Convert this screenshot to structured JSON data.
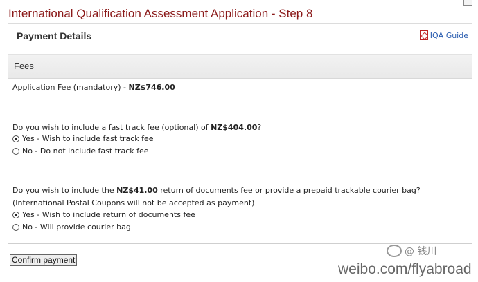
{
  "header": {
    "title": "International Qualification Assessment Application - Step 8"
  },
  "panel": {
    "section_title": "Payment Details",
    "guide_link": "IQA Guide",
    "guide_icon": "pdf-icon"
  },
  "fees": {
    "heading": "Fees",
    "application_fee_label": "Application Fee (mandatory) - ",
    "application_fee_amount": "NZ$746.00"
  },
  "fast_track": {
    "question_prefix": "Do you wish to include a fast track fee (optional) of ",
    "question_amount": "NZ$404.00",
    "question_suffix": "?",
    "options": [
      {
        "label": "Yes - Wish to include fast track fee",
        "selected": true
      },
      {
        "label": "No - Do not include fast track fee",
        "selected": false
      }
    ]
  },
  "return_docs": {
    "question_prefix": "Do you wish to include the ",
    "question_amount": "NZ$41.00",
    "question_suffix": " return of documents fee or provide a prepaid trackable courier bag?",
    "note": "(International Postal Coupons will not be accepted as payment)",
    "options": [
      {
        "label": "Yes - Wish to include return of documents fee",
        "selected": true
      },
      {
        "label": "No - Will provide courier bag",
        "selected": false
      }
    ]
  },
  "actions": {
    "confirm_label": "Confirm payment"
  },
  "watermark": {
    "handle": "@ 钱川",
    "url": "weibo.com/flyabroad"
  }
}
